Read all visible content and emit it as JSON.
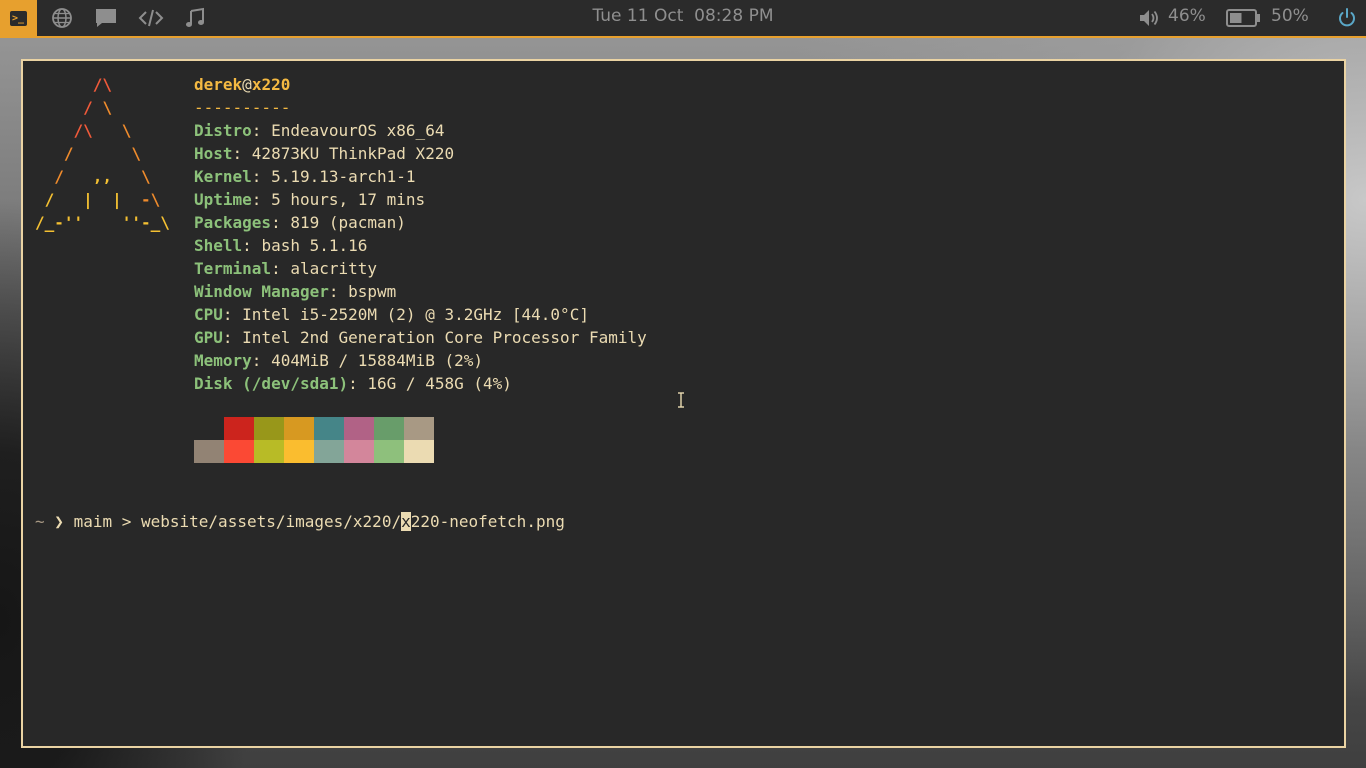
{
  "topbar": {
    "terminal_icon_glyph": ">_",
    "workspaces": [
      {
        "icon": "globe-icon"
      },
      {
        "icon": "chat-icon"
      },
      {
        "icon": "code-icon"
      },
      {
        "icon": "music-icon"
      }
    ],
    "clock": {
      "date": "Tue 11 Oct",
      "time": "08:28 PM"
    },
    "volume": {
      "icon": "speaker-icon",
      "text": "46%"
    },
    "battery": {
      "icon": "battery-icon",
      "text": "50%",
      "level": 0.5
    },
    "power": {
      "icon": "power-icon"
    },
    "accent": "#e7a02e"
  },
  "terminal": {
    "header": {
      "user": "derek",
      "at": "@",
      "host": "x220",
      "separator": "----------"
    },
    "info": [
      {
        "key": "Distro",
        "value": "EndeavourOS x86_64"
      },
      {
        "key": "Host",
        "value": "42873KU ThinkPad X220"
      },
      {
        "key": "Kernel",
        "value": "5.19.13-arch1-1"
      },
      {
        "key": "Uptime",
        "value": "5 hours, 17 mins"
      },
      {
        "key": "Packages",
        "value": "819 (pacman)"
      },
      {
        "key": "Shell",
        "value": "bash 5.1.16"
      },
      {
        "key": "Terminal",
        "value": "alacritty"
      },
      {
        "key": "Window Manager",
        "value": "bspwm"
      },
      {
        "key": "CPU",
        "value": "Intel i5-2520M (2) @ 3.2GHz [44.0°C]"
      },
      {
        "key": "GPU",
        "value": "Intel 2nd Generation Core Processor Family"
      },
      {
        "key": "Memory",
        "value": "404MiB / 15884MiB (2%)"
      },
      {
        "key": "Disk (/dev/sda1)",
        "value": "16G / 458G (4%)"
      }
    ],
    "palette_top": [
      "#282828",
      "#cc241d",
      "#98971a",
      "#d79921",
      "#458588",
      "#b16286",
      "#689d6a",
      "#a89984"
    ],
    "palette_bottom": [
      "#928374",
      "#fb4934",
      "#b8bb26",
      "#fabd2f",
      "#83a598",
      "#d3869b",
      "#8ec07c",
      "#ebdbb2"
    ],
    "prompt": {
      "dir": "~",
      "symbol": "❯",
      "command_before_cursor": "maim > website/assets/images/x220/",
      "cursor_char": "x",
      "command_after_cursor": "220-neofetch.png"
    }
  }
}
